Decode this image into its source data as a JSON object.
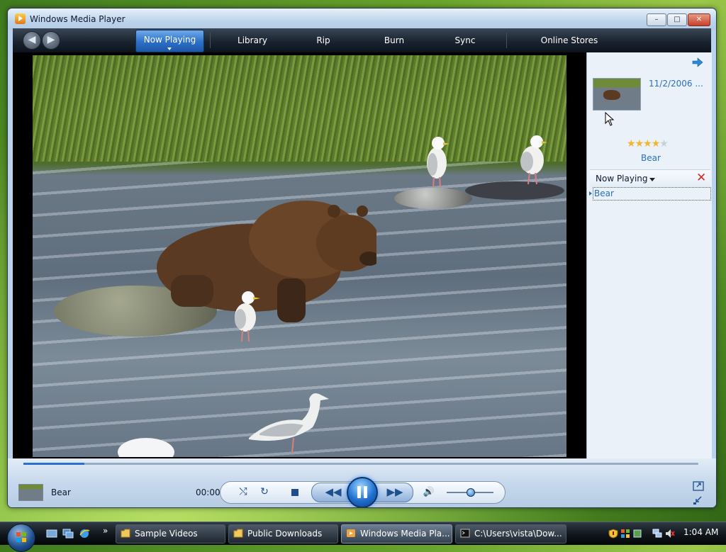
{
  "window": {
    "title": "Windows Media Player",
    "minimize": "–",
    "maximize": "□",
    "close": "✕"
  },
  "nav": {
    "back_icon": "back-arrow-icon",
    "forward_icon": "forward-arrow-icon",
    "tabs": [
      {
        "label": "Now Playing",
        "active": true
      },
      {
        "label": "Library"
      },
      {
        "label": "Rip"
      },
      {
        "label": "Burn"
      },
      {
        "label": "Sync"
      },
      {
        "label": "Online Stores"
      }
    ]
  },
  "side": {
    "date": "11/2/2006 ...",
    "rating": 4,
    "rating_max": 5,
    "album_title": "Bear",
    "now_playing_label": "Now Playing",
    "playlist": [
      "Bear"
    ]
  },
  "controls": {
    "track_name": "Bear",
    "time": "00:00",
    "seek_progress": 0.09,
    "volume_level": 0.5,
    "accent": "#2d6fd0"
  },
  "taskbar": {
    "tasks": [
      {
        "label": "Sample Videos",
        "icon": "folder-icon"
      },
      {
        "label": "Public Downloads",
        "icon": "folder-icon"
      },
      {
        "label": "Windows Media Pla...",
        "icon": "wmp-icon",
        "active": true
      },
      {
        "label": "C:\\Users\\vista\\Dow...",
        "icon": "cmd-icon"
      }
    ],
    "clock": "1:04 AM",
    "more": "»"
  }
}
